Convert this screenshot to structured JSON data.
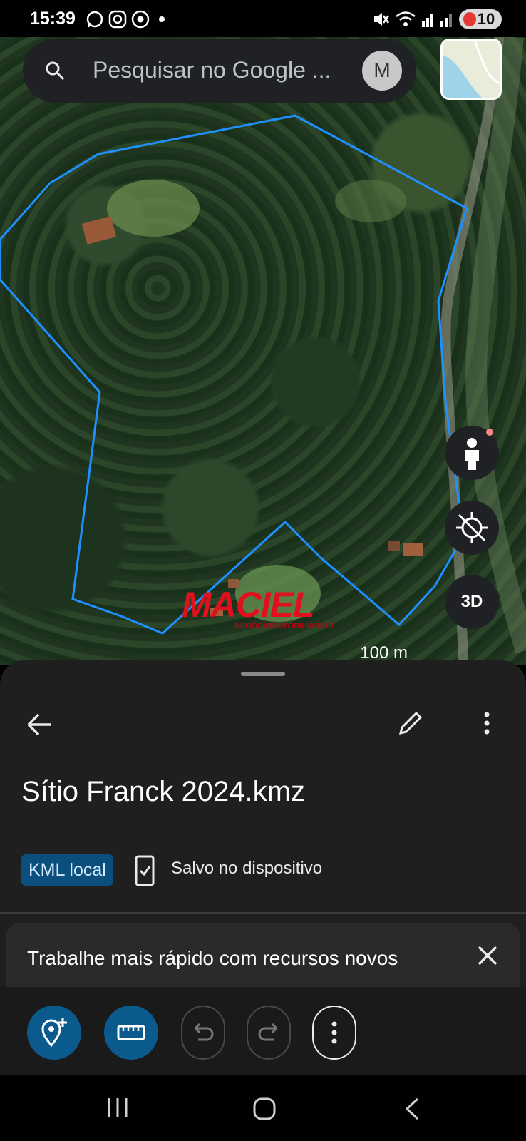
{
  "status_bar": {
    "time": "15:39",
    "battery": "10",
    "icons": [
      "whatsapp-icon",
      "instagram-icon",
      "chrome-icon",
      "dot-icon",
      "mute-icon",
      "wifi-icon",
      "signal-icon",
      "signal-icon",
      "battery-icon"
    ]
  },
  "search": {
    "placeholder": "Pesquisar no Google ...",
    "avatar_letter": "M"
  },
  "map": {
    "buttons": {
      "three_d": "3D"
    },
    "scale_label": "100 m",
    "boundary_color": "#1e90ff",
    "watermark": {
      "title": "MACIEL",
      "subtitle": "NEGÓCIOS IMOBILIÁRIOS"
    }
  },
  "sheet": {
    "title": "Sítio Franck 2024.kmz",
    "badge": "KML local",
    "saved_label": "Salvo no dispositivo",
    "promo_text": "Trabalhe mais rápido com recursos novos"
  },
  "toolbar": {
    "buttons": [
      "add-pin-icon",
      "ruler-icon",
      "undo-icon",
      "redo-icon",
      "more-vert-icon"
    ]
  },
  "colors": {
    "accent": "#0b5a8e",
    "badge_bg": "#0b4f7e",
    "sheet_bg": "#1f1f1f"
  }
}
